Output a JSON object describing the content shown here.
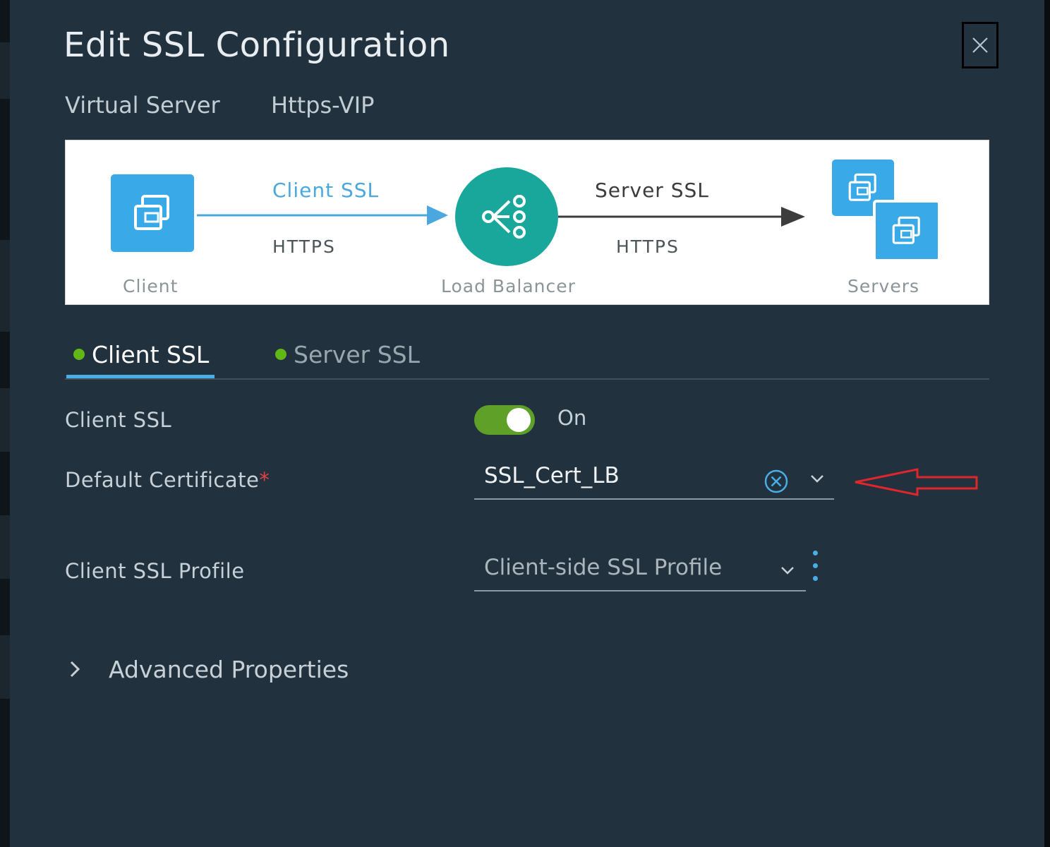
{
  "dialog": {
    "title": "Edit SSL Configuration",
    "close_icon": "close-icon"
  },
  "context": {
    "object_type": "Virtual Server",
    "object_name": "Https-VIP"
  },
  "diagram": {
    "client_label": "Client",
    "client_ssl_label": "Client SSL",
    "client_protocol": "HTTPS",
    "load_balancer_label": "Load Balancer",
    "server_ssl_label": "Server SSL",
    "server_protocol": "HTTPS",
    "servers_label": "Servers",
    "colors": {
      "client_ssl": "#4aa8de",
      "server_ssl": "#3c3c3c",
      "node_blue": "#39a9e8",
      "load_balancer_teal": "#19a79b"
    }
  },
  "tabs": [
    {
      "label": "Client SSL",
      "active": true,
      "status_color": "#61b715"
    },
    {
      "label": "Server SSL",
      "active": false,
      "status_color": "#61b715"
    }
  ],
  "form": {
    "client_ssl": {
      "label": "Client SSL",
      "state": "On",
      "enabled": true
    },
    "default_certificate": {
      "label": "Default Certificate",
      "required_mark": "*",
      "value": "SSL_Cert_LB"
    },
    "client_ssl_profile": {
      "label": "Client SSL Profile",
      "placeholder": "Client-side SSL Profile"
    },
    "advanced": {
      "label": "Advanced Properties",
      "expanded": false
    }
  },
  "annotation": {
    "arrow_color": "#e0262d",
    "points_to": "default_certificate"
  }
}
